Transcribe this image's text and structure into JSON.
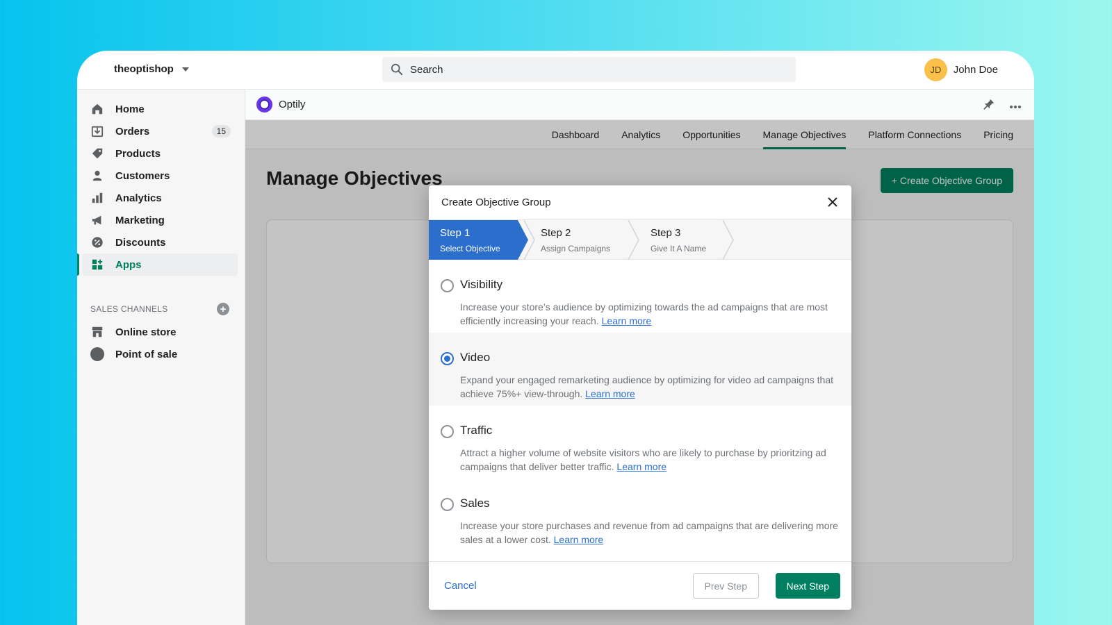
{
  "topbar": {
    "store_name": "theoptishop",
    "search_placeholder": "Search",
    "user_initials": "JD",
    "user_name": "John Doe"
  },
  "sidebar": {
    "items": [
      {
        "label": "Home",
        "icon": "home-icon"
      },
      {
        "label": "Orders",
        "icon": "orders-icon",
        "badge": "15"
      },
      {
        "label": "Products",
        "icon": "tag-icon"
      },
      {
        "label": "Customers",
        "icon": "person-icon"
      },
      {
        "label": "Analytics",
        "icon": "bar-chart-icon"
      },
      {
        "label": "Marketing",
        "icon": "megaphone-icon"
      },
      {
        "label": "Discounts",
        "icon": "discount-icon"
      },
      {
        "label": "Apps",
        "icon": "apps-icon",
        "active": true
      }
    ],
    "sales_channels_title": "SALES CHANNELS",
    "channels": [
      {
        "label": "Online store",
        "icon": "store-icon"
      },
      {
        "label": "Point of sale",
        "icon": "point-of-sale-icon"
      }
    ]
  },
  "app": {
    "name": "Optily",
    "tabs": [
      "Dashboard",
      "Analytics",
      "Opportunities",
      "Manage Objectives",
      "Platform Connections",
      "Pricing"
    ],
    "active_tab": "Manage Objectives",
    "page_title": "Manage Objectives",
    "create_button": "+ Create Objective Group"
  },
  "modal": {
    "title": "Create Objective Group",
    "steps": [
      {
        "title": "Step 1",
        "subtitle": "Select Objective",
        "active": true
      },
      {
        "title": "Step 2",
        "subtitle": "Assign Campaigns"
      },
      {
        "title": "Step 3",
        "subtitle": "Give It A Name"
      }
    ],
    "options": [
      {
        "title": "Visibility",
        "desc": "Increase your store’s audience by optimizing towards the ad campaigns that are most efficiently increasing your reach.",
        "link": "Learn more",
        "selected": false
      },
      {
        "title": "Video",
        "desc": "Expand your engaged remarketing audience by optimizing for video ad campaigns that achieve 75%+ view-through.",
        "link": "Learn more",
        "selected": true
      },
      {
        "title": "Traffic",
        "desc": "Attract a higher volume of website visitors who are likely to purchase by prioritzing ad campaigns that deliver better traffic.",
        "link": "Learn more",
        "selected": false
      },
      {
        "title": "Sales",
        "desc": "Increase your store purchases and revenue from ad campaigns that are delivering more sales at a lower cost.",
        "link": "Learn more",
        "selected": false
      }
    ],
    "cancel": "Cancel",
    "prev": "Prev Step",
    "next": "Next Step"
  },
  "colors": {
    "accent_green": "#008060",
    "step_blue": "#2c6ecb",
    "link_blue": "#2c6ecb",
    "avatar_yellow": "#f9c04a",
    "app_purple": "#6a33ec"
  }
}
